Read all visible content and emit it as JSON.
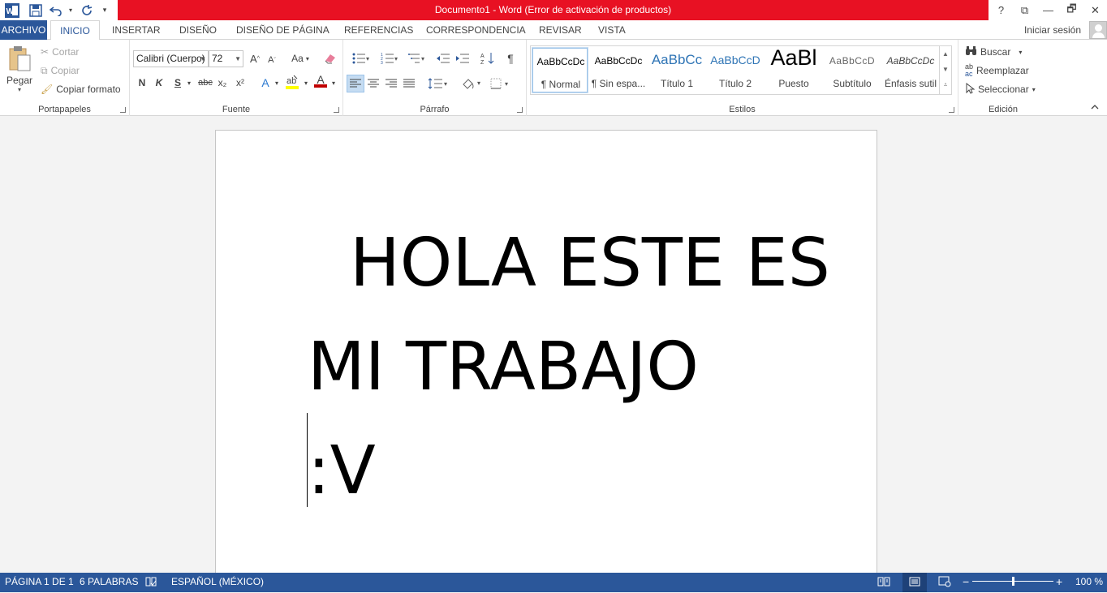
{
  "window": {
    "title": "Documento1 -  Word (Error de activación de productos)",
    "controls": [
      "?",
      "⧉",
      "—",
      "🗗",
      "✕"
    ]
  },
  "qat": {
    "word_icon": "W",
    "save": "save-icon",
    "undo": "undo-icon",
    "redo": "redo-icon"
  },
  "tabs": {
    "file": "ARCHIVO",
    "items": [
      "INICIO",
      "INSERTAR",
      "DISEÑO",
      "DISEÑO DE PÁGINA",
      "REFERENCIAS",
      "CORRESPONDENCIA",
      "REVISAR",
      "VISTA"
    ],
    "active": "INICIO",
    "signin": "Iniciar sesión"
  },
  "clipboard": {
    "paste": "Pegar",
    "cut": "Cortar",
    "copy": "Copiar",
    "format_painter": "Copiar formato",
    "label": "Portapapeles"
  },
  "font": {
    "family": "Calibri (Cuerpo)",
    "size": "72",
    "grow": "A",
    "shrink": "A",
    "case": "Aa",
    "bold": "N",
    "italic": "K",
    "underline": "S",
    "strike": "abc",
    "subscript": "x₂",
    "superscript": "x²",
    "effects": "A",
    "color": "A",
    "label": "Fuente",
    "highlight_color": "#ffff00",
    "font_color": "#c00000"
  },
  "paragraph": {
    "pilcrow": "¶",
    "label": "Párrafo"
  },
  "styles": {
    "items": [
      {
        "preview": "AaBbCcDc",
        "name": "¶ Normal"
      },
      {
        "preview": "AaBbCcDc",
        "name": "¶ Sin espa..."
      },
      {
        "preview": "AaBbCc",
        "name": "Título 1"
      },
      {
        "preview": "AaBbCcD",
        "name": "Título 2"
      },
      {
        "preview": "AaBl",
        "name": "Puesto"
      },
      {
        "preview": "AaBbCcD",
        "name": "Subtítulo"
      },
      {
        "preview": "AaBbCcDc",
        "name": "Énfasis sutil"
      }
    ],
    "label": "Estilos"
  },
  "editing": {
    "find": "Buscar",
    "replace": "Reemplazar",
    "select": "Seleccionar",
    "label": "Edición"
  },
  "document": {
    "lines": [
      "  HOLA ESTE ES",
      "MI TRABAJO",
      ":V"
    ]
  },
  "status": {
    "page": "PÁGINA 1 DE 1",
    "words": "6 PALABRAS",
    "language": "ESPAÑOL (MÉXICO)",
    "zoom": "100 %"
  },
  "colors": {
    "accent": "#2b579a",
    "title_error": "#e81123"
  }
}
